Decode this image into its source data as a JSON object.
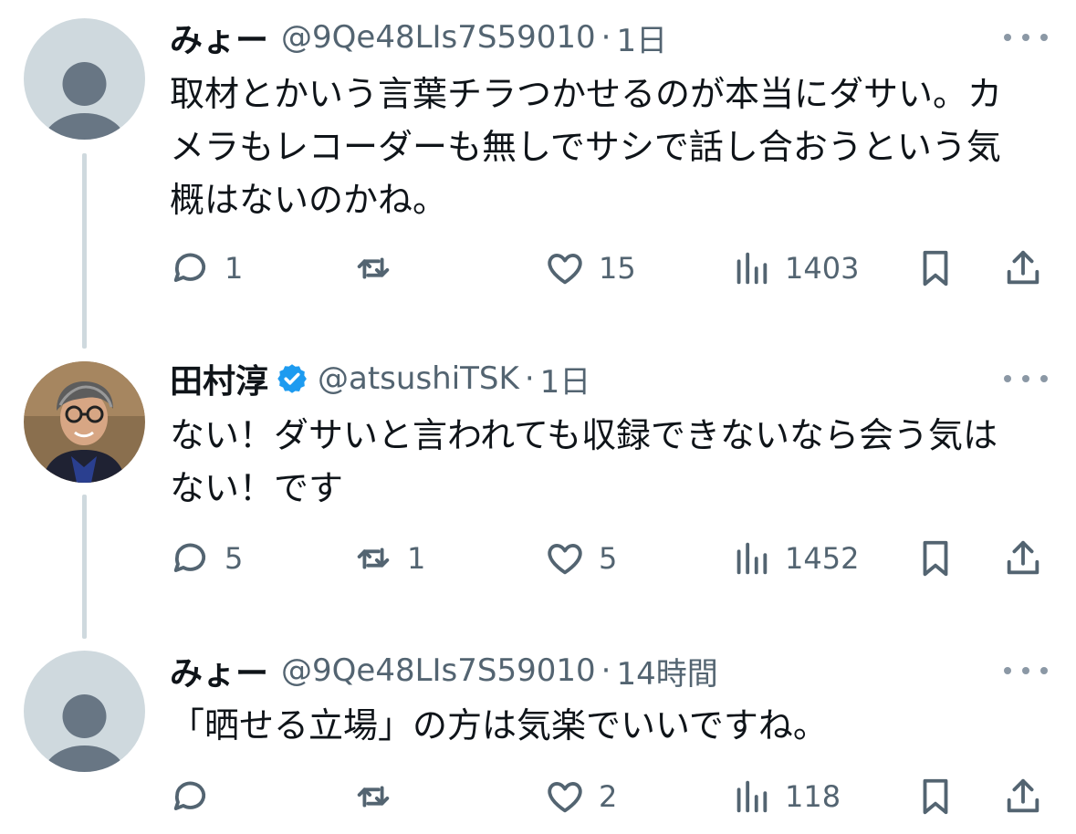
{
  "tweets": [
    {
      "name": "みょー",
      "handle": "@9Qe48LIs7S59010",
      "separator": "·",
      "time": "1日",
      "text": "取材とかいう言葉チラつかせるのが本当にダサい。カメラもレコーダーも無しでサシで話し合おうという気概はないのかね。",
      "replies": "1",
      "retweets": "",
      "likes": "15",
      "views": "1403",
      "verified": false
    },
    {
      "name": "田村淳",
      "handle": "@atsushiTSK",
      "separator": "·",
      "time": "1日",
      "text": "ない！ダサいと言われても収録できないなら会う気はない！です",
      "replies": "5",
      "retweets": "1",
      "likes": "5",
      "views": "1452",
      "verified": true
    },
    {
      "name": "みょー",
      "handle": "@9Qe48LIs7S59010",
      "separator": "·",
      "time": "14時間",
      "text": "「晒せる立場」の方は気楽でいいですね。",
      "replies": "",
      "retweets": "",
      "likes": "2",
      "views": "118",
      "verified": false
    }
  ],
  "icons": {
    "reply": "speech-bubble-icon",
    "retweet": "retweet-arrows-icon",
    "like": "heart-icon",
    "views": "bar-chart-icon",
    "bookmark": "bookmark-icon",
    "share": "share-upload-icon",
    "more": "ellipsis-icon",
    "verified": "verified-badge-icon"
  },
  "colors": {
    "text": "#0f1419",
    "secondary": "#536471",
    "thread_line": "#cfd9de",
    "verified": "#1d9bf0"
  }
}
